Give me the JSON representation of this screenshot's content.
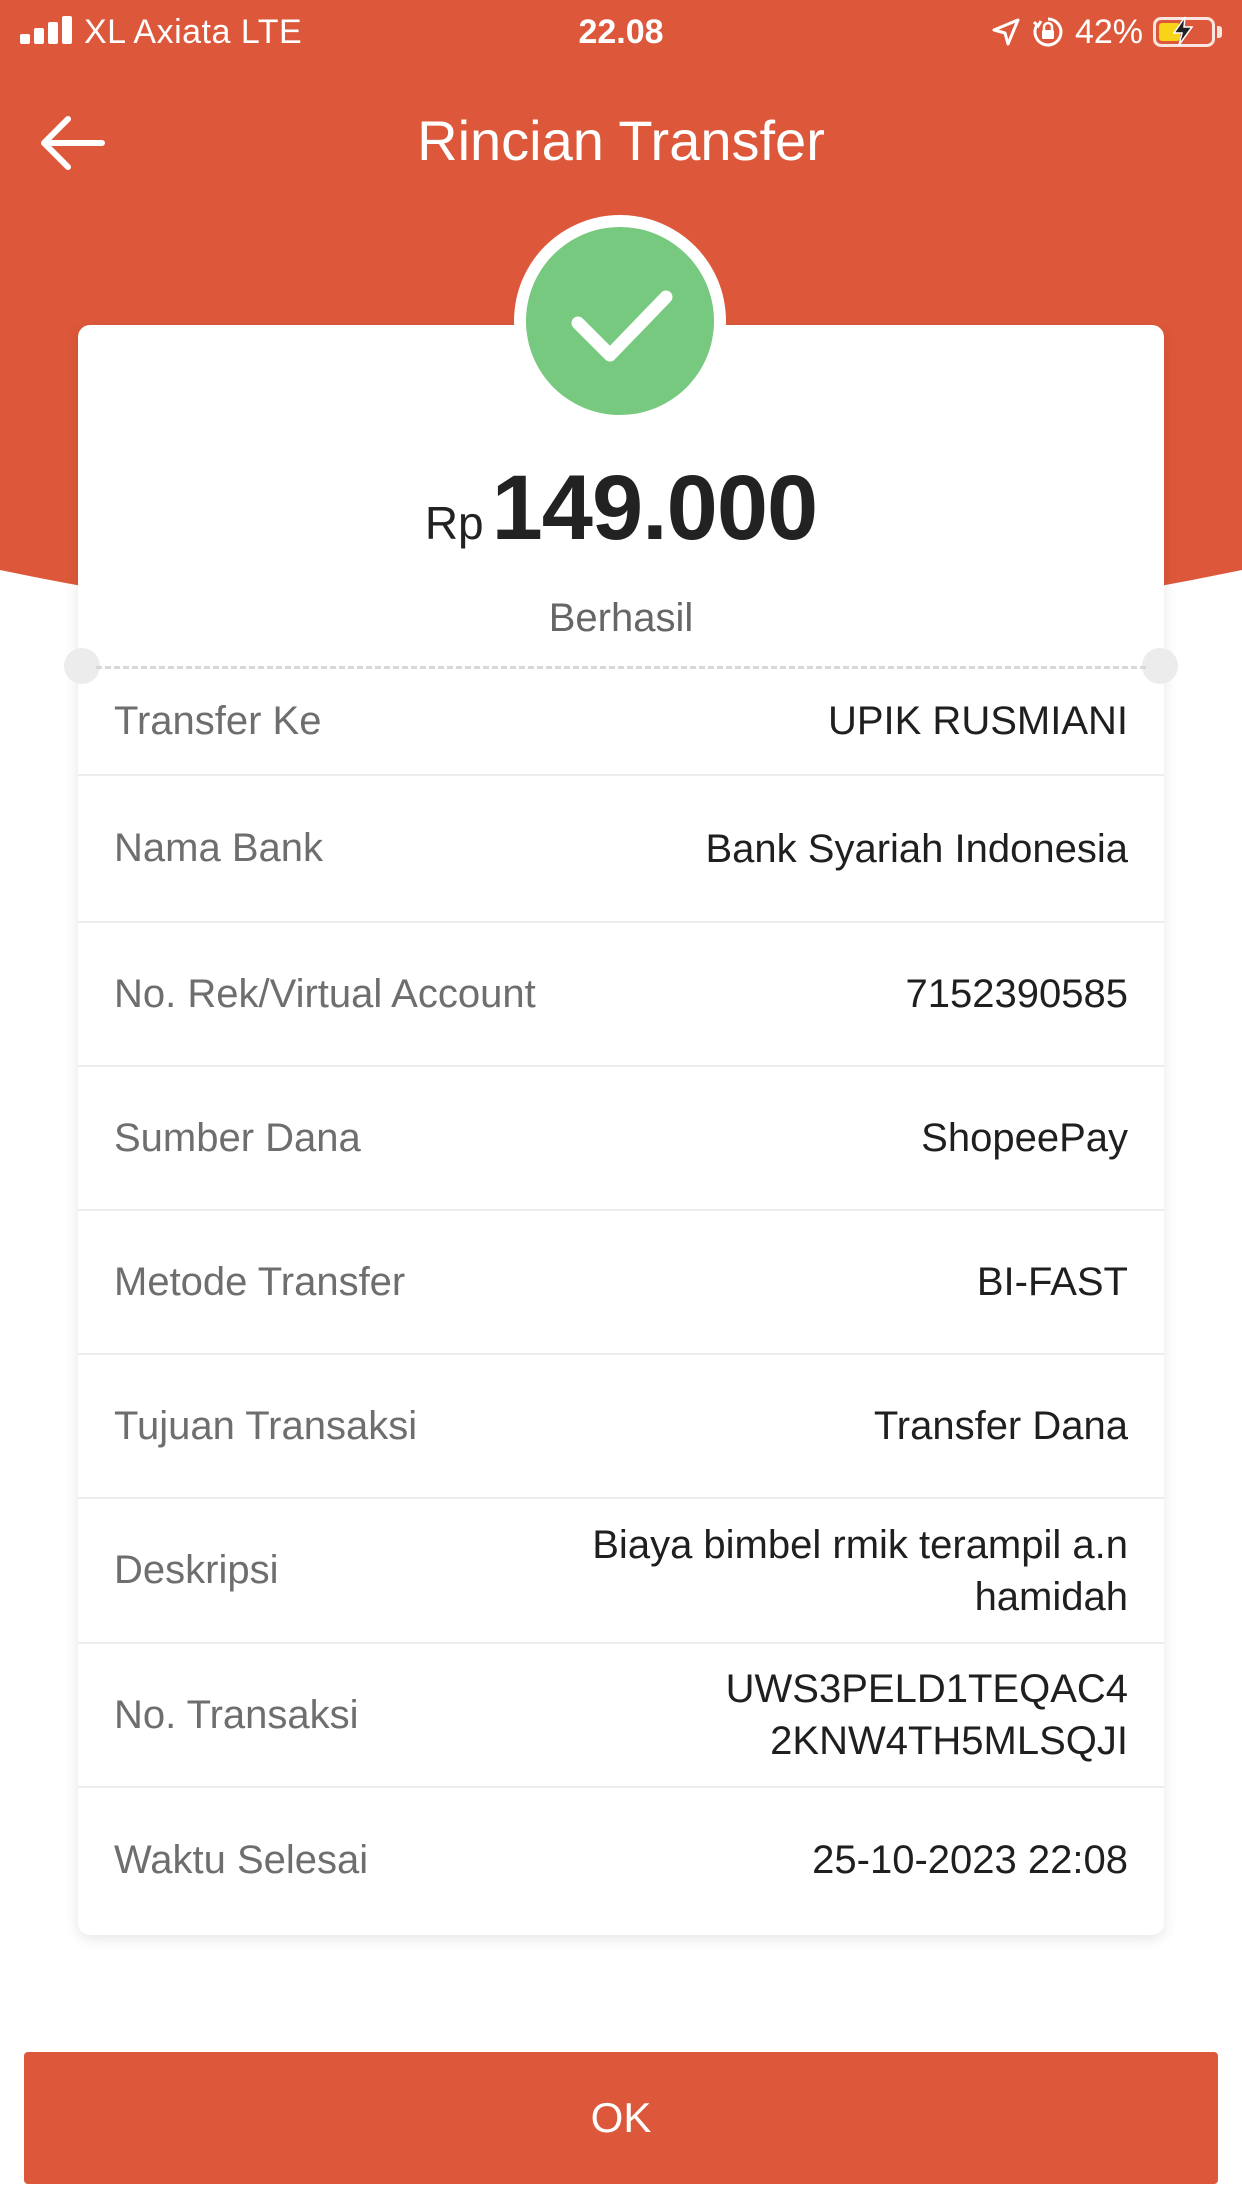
{
  "status_bar": {
    "carrier": "XL Axiata  LTE",
    "time": "22.08",
    "battery": "42%",
    "battery_level": 0.42
  },
  "header": {
    "title": "Rincian Transfer",
    "back_icon": "arrow-left-icon"
  },
  "summary": {
    "currency": "Rp",
    "amount": "149.000",
    "status": "Berhasil",
    "status_icon": "checkmark-icon",
    "status_color": "#76c97e"
  },
  "details": [
    {
      "label": "Transfer Ke",
      "value": "UPIK RUSMIANI"
    },
    {
      "label": "Nama Bank",
      "value": "Bank Syariah Indonesia"
    },
    {
      "label": "No. Rek/Virtual Account",
      "value": "7152390585"
    },
    {
      "label": "Sumber Dana",
      "value": "ShopeePay"
    },
    {
      "label": "Metode Transfer",
      "value": "BI-FAST"
    },
    {
      "label": "Tujuan Transaksi",
      "value": "Transfer Dana"
    },
    {
      "label": "Deskripsi",
      "value": "Biaya bimbel rmik terampil a.n hamidah"
    },
    {
      "label": "No. Transaksi",
      "value": "UWS3PELD1TEQAC4 2KNW4TH5MLSQJI"
    },
    {
      "label": "Waktu Selesai",
      "value": "25-10-2023 22:08"
    }
  ],
  "footer": {
    "ok_label": "OK"
  },
  "colors": {
    "brand": "#dd583a",
    "success": "#76c97e"
  }
}
